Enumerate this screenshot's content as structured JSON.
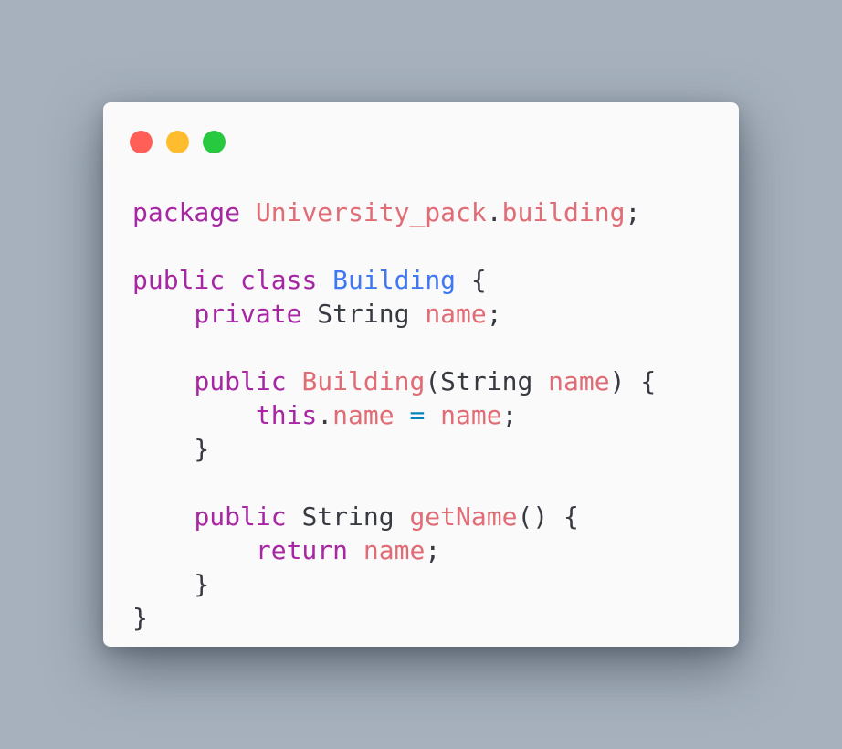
{
  "window": {
    "traffic_lights": [
      {
        "name": "close",
        "color": "#ff5f56"
      },
      {
        "name": "minimize",
        "color": "#ffbd2e"
      },
      {
        "name": "maximize",
        "color": "#27c93f"
      }
    ]
  },
  "colors": {
    "background": "#a6b1bd",
    "editor_background": "#fafafa",
    "keyword": "#a626a4",
    "class_name": "#4078f2",
    "identifier": "#e06c75",
    "operator": "#0184bc",
    "plain": "#383a42"
  },
  "code": {
    "language": "java",
    "lines": [
      [
        {
          "t": "package",
          "k": "kw"
        },
        {
          "t": " ",
          "k": "plain"
        },
        {
          "t": "University_pack",
          "k": "id"
        },
        {
          "t": ".",
          "k": "plain"
        },
        {
          "t": "building",
          "k": "id"
        },
        {
          "t": ";",
          "k": "plain"
        }
      ],
      [],
      [
        {
          "t": "public",
          "k": "kw"
        },
        {
          "t": " ",
          "k": "plain"
        },
        {
          "t": "class",
          "k": "kw"
        },
        {
          "t": " ",
          "k": "plain"
        },
        {
          "t": "Building",
          "k": "cls"
        },
        {
          "t": " {",
          "k": "plain"
        }
      ],
      [
        {
          "t": "    ",
          "k": "plain"
        },
        {
          "t": "private",
          "k": "kw"
        },
        {
          "t": " String ",
          "k": "plain"
        },
        {
          "t": "name",
          "k": "id"
        },
        {
          "t": ";",
          "k": "plain"
        }
      ],
      [],
      [
        {
          "t": "    ",
          "k": "plain"
        },
        {
          "t": "public",
          "k": "kw"
        },
        {
          "t": " ",
          "k": "plain"
        },
        {
          "t": "Building",
          "k": "id"
        },
        {
          "t": "(String ",
          "k": "plain"
        },
        {
          "t": "name",
          "k": "id"
        },
        {
          "t": ") {",
          "k": "plain"
        }
      ],
      [
        {
          "t": "        ",
          "k": "plain"
        },
        {
          "t": "this",
          "k": "kw"
        },
        {
          "t": ".",
          "k": "plain"
        },
        {
          "t": "name",
          "k": "id"
        },
        {
          "t": " ",
          "k": "plain"
        },
        {
          "t": "=",
          "k": "op"
        },
        {
          "t": " ",
          "k": "plain"
        },
        {
          "t": "name",
          "k": "id"
        },
        {
          "t": ";",
          "k": "plain"
        }
      ],
      [
        {
          "t": "    }",
          "k": "plain"
        }
      ],
      [],
      [
        {
          "t": "    ",
          "k": "plain"
        },
        {
          "t": "public",
          "k": "kw"
        },
        {
          "t": " String ",
          "k": "plain"
        },
        {
          "t": "getName",
          "k": "id"
        },
        {
          "t": "() {",
          "k": "plain"
        }
      ],
      [
        {
          "t": "        ",
          "k": "plain"
        },
        {
          "t": "return",
          "k": "kw"
        },
        {
          "t": " ",
          "k": "plain"
        },
        {
          "t": "name",
          "k": "id"
        },
        {
          "t": ";",
          "k": "plain"
        }
      ],
      [
        {
          "t": "    }",
          "k": "plain"
        }
      ],
      [
        {
          "t": "}",
          "k": "plain"
        }
      ]
    ]
  }
}
